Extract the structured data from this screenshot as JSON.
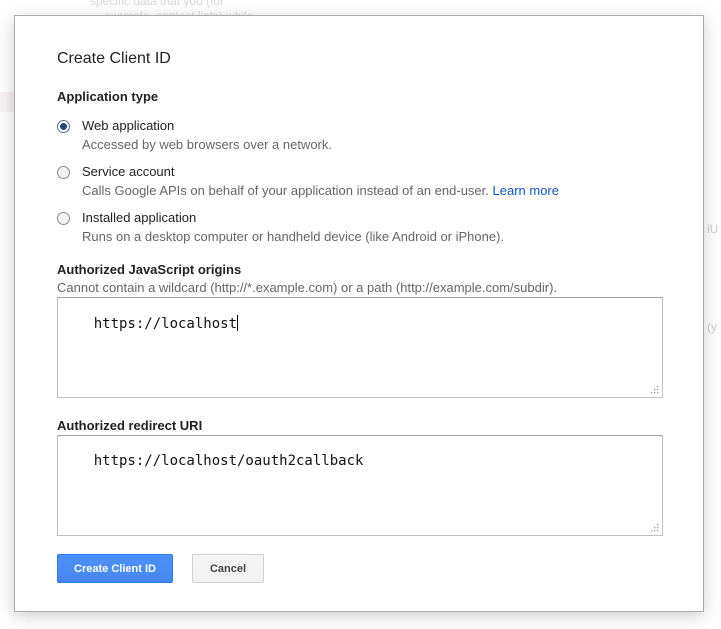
{
  "background": {
    "line1": "specific data that you (for",
    "line2": "example, contact lists) while",
    "edge1": "iU",
    "edge2": "(y"
  },
  "dialog": {
    "title": "Create Client ID",
    "application_type": {
      "label": "Application type",
      "options": [
        {
          "label": "Web application",
          "description": "Accessed by web browsers over a network.",
          "checked": true
        },
        {
          "label": "Service account",
          "description": "Calls Google APIs on behalf of your application instead of an end-user.",
          "link": "Learn more",
          "checked": false
        },
        {
          "label": "Installed application",
          "description": "Runs on a desktop computer or handheld device (like Android or iPhone).",
          "checked": false
        }
      ]
    },
    "js_origins": {
      "label": "Authorized JavaScript origins",
      "help": "Cannot contain a wildcard (http://*.example.com) or a path (http://example.com/subdir).",
      "value": "https://localhost"
    },
    "redirect_uri": {
      "label": "Authorized redirect URI",
      "value": "https://localhost/oauth2callback"
    },
    "buttons": {
      "create": "Create Client ID",
      "cancel": "Cancel"
    }
  },
  "colors": {
    "primary_button": "#4d90fe",
    "link": "#1155cc"
  }
}
